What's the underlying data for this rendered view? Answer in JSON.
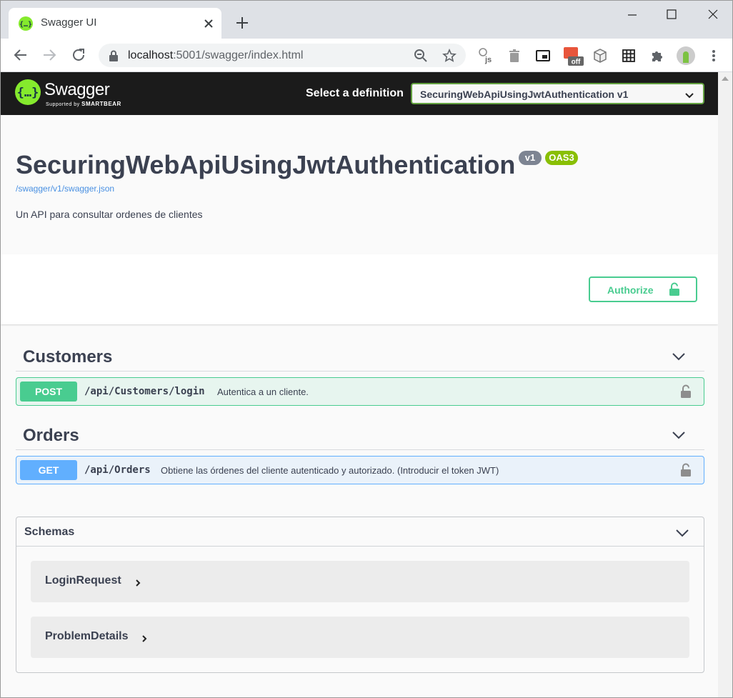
{
  "browser": {
    "tab_title": "Swagger UI",
    "url_host": "localhost",
    "url_path": ":5001/swagger/index.html",
    "extension_off_badge": "off"
  },
  "topbar": {
    "logo_text": "Swagger",
    "logo_sub_prefix": "Supported by",
    "logo_sub_brand": "SMARTBEAR",
    "definition_label": "Select a definition",
    "definition_selected": "SecuringWebApiUsingJwtAuthentication v1"
  },
  "info": {
    "title": "SecuringWebApiUsingJwtAuthentication",
    "version_badge": "v1",
    "oas_badge": "OAS3",
    "spec_link": "/swagger/v1/swagger.json",
    "description": "Un API para consultar ordenes de clientes"
  },
  "scheme": {
    "authorize_label": "Authorize"
  },
  "tags": [
    {
      "name": "Customers",
      "operations": [
        {
          "method": "POST",
          "path": "/api/Customers/login",
          "summary": "Autentica a un cliente."
        }
      ]
    },
    {
      "name": "Orders",
      "operations": [
        {
          "method": "GET",
          "path": "/api/Orders",
          "summary": "Obtiene las órdenes del cliente autenticado y autorizado. (Introducir el token JWT)"
        }
      ]
    }
  ],
  "schemas": {
    "title": "Schemas",
    "models": [
      "LoginRequest",
      "ProblemDetails"
    ]
  },
  "colors": {
    "swagger_green": "#85ea2d",
    "post": "#49cc90",
    "get": "#61affe",
    "topbar": "#1b1b1b",
    "oas_badge": "#89bf04",
    "version_badge": "#7d8492"
  },
  "icons": {
    "tab": "swagger-favicon",
    "toolbar": [
      "back-arrow-icon",
      "forward-arrow-icon",
      "reload-icon",
      "lock-icon",
      "zoom-out-icon",
      "star-icon"
    ],
    "extensions": [
      "js-extension-icon",
      "trash-icon",
      "picture-in-picture-icon",
      "cookie-off-extension-icon",
      "cube-icon",
      "grid-icon",
      "puzzle-icon",
      "profile-avatar-icon",
      "kebab-menu-icon"
    ]
  }
}
